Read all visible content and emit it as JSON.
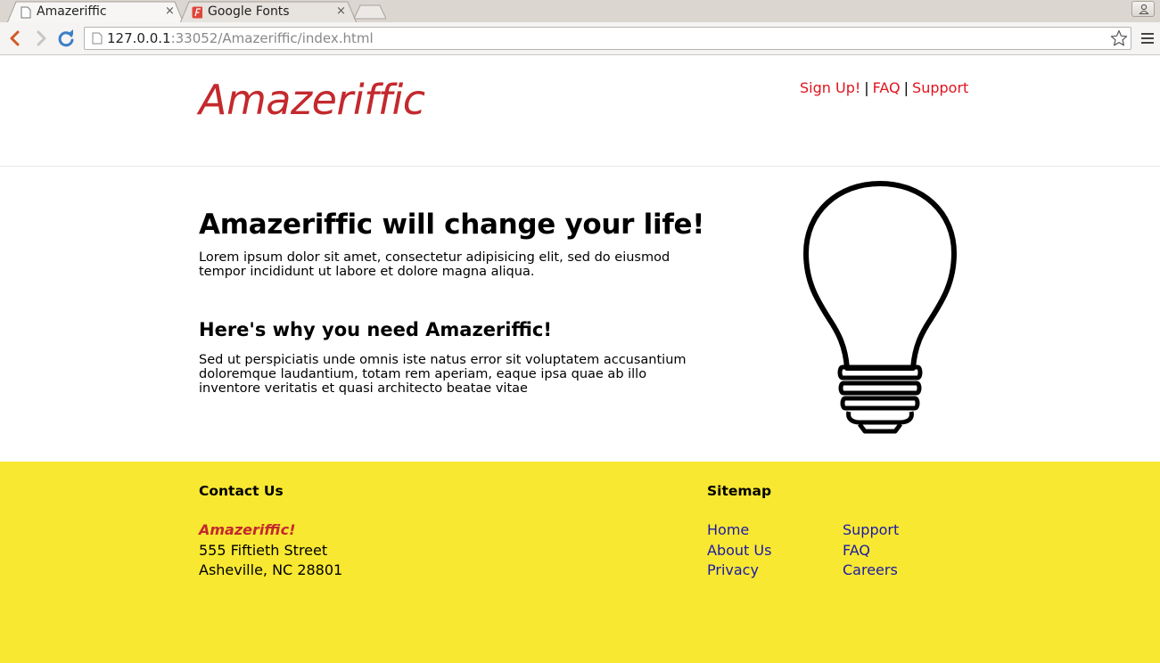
{
  "browser": {
    "tabs": [
      {
        "title": "Amazeriffic",
        "close": "×",
        "active": true
      },
      {
        "title": "Google Fonts",
        "close": "×",
        "active": false
      }
    ],
    "url_host": "127.0.0.1",
    "url_path": ":33052/Amazeriffic/index.html"
  },
  "header": {
    "logo": "Amazeriffic",
    "nav": [
      {
        "label": "Sign Up!"
      },
      {
        "label": "FAQ"
      },
      {
        "label": "Support"
      }
    ],
    "separator": "|"
  },
  "main": {
    "headline": "Amazeriffic will change your life!",
    "intro_line1": "Lorem ipsum dolor sit amet, consectetur adipisicing elit, sed do eiusmod",
    "intro_line2": "tempor incididunt ut labore et dolore magna aliqua.",
    "subhead": "Here's why you need Amazeriffic!",
    "why_line1": "Sed ut perspiciatis unde omnis iste natus error sit voluptatem accusantium",
    "why_line2": "doloremque laudantium, totam rem aperiam, eaque ipsa quae ab illo",
    "why_line3": "inventore veritatis et quasi architecto beatae vitae",
    "image_icon": "lightbulb-icon"
  },
  "footer": {
    "contact_heading": "Contact Us",
    "company": "Amazeriffic!",
    "street": "555 Fiftieth Street",
    "city": "Asheville, NC 28801",
    "sitemap_heading": "Sitemap",
    "sitemap_col1": [
      "Home",
      "About Us",
      "Privacy"
    ],
    "sitemap_col2": [
      "Support",
      "FAQ",
      "Careers"
    ]
  },
  "colors": {
    "brand_red": "#c3292d",
    "nav_link": "#e0141e",
    "footer_bg": "#f8e831",
    "footer_link": "#1a1aa6"
  }
}
